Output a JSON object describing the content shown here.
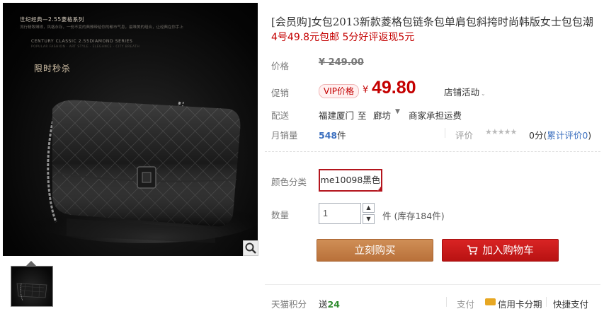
{
  "image_panel": {
    "brand_title": "世纪经典—2.55菱格系列",
    "brand_subtitle": "流行精致琳琅，风格永存，一份不变的典雅带给你的都市气息，最唯美的组合，让经典在你手上",
    "brand_en": "CENTURY CLASSIC 2.55DIAMOND SERIES",
    "brand_en_sub": "POPULAR FASHION · ART STYLE · ELEGANCE · CITY BREATH",
    "flash_sale": "限时秒杀",
    "zoom_icon": "magnifier-icon",
    "thumbnail_icon": "bag-thumbnail"
  },
  "product": {
    "title": "[会员购]女包2013新款菱格包链条包单肩包斜挎时尚韩版女士包包潮",
    "promo": "4号49.8元包邮 5分好评返现5元"
  },
  "price": {
    "label": "价格",
    "original": "¥ 249.00"
  },
  "promotion": {
    "label": "促销",
    "badge": "VIP价格",
    "currency": "¥",
    "value": "49.80",
    "shop_activity": "店铺活动"
  },
  "shipping": {
    "label": "配送",
    "from": "福建厦门",
    "to_word": "至",
    "destination": "廊坊",
    "fee": "商家承担运费"
  },
  "sales": {
    "label": "月销量",
    "count": "548",
    "unit": "件",
    "review_label": "评价",
    "stars_icon": "rating-stars-icon",
    "rating": "0",
    "score_prefix": "0分(",
    "score_link": "累计评价0",
    "score_suffix": ")"
  },
  "options": {
    "color_label": "颜色分类",
    "color_value": "me10098黑色",
    "qty_label": "数量",
    "qty_value": "1",
    "stock": "件 (库存184件)"
  },
  "actions": {
    "buy_now": "立刻购买",
    "add_cart": "加入购物车",
    "cart_icon": "cart-icon"
  },
  "footer": {
    "points_label": "天猫积分",
    "points_prefix": "送",
    "points_value": "24",
    "pay_label": "支付",
    "credit_card": "信用卡分期",
    "quick_pay": "快捷支付"
  },
  "colors": {
    "accent_red": "#c40000",
    "buy_orange": "#c17b42",
    "cart_red": "#c81a1a",
    "link_blue": "#3b6fbf"
  }
}
